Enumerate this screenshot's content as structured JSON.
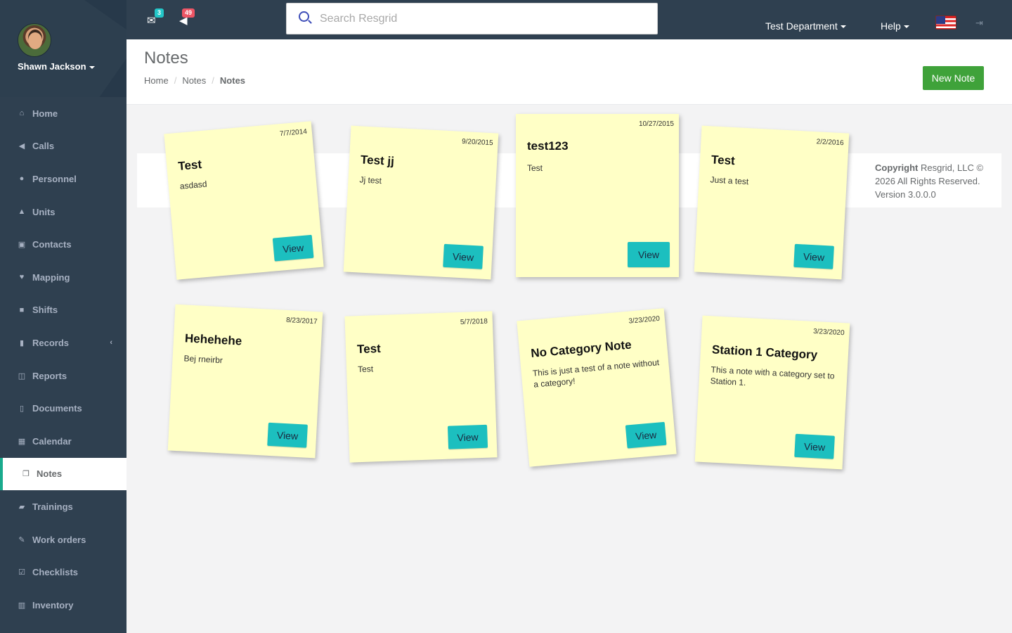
{
  "user": {
    "name": "Shawn Jackson"
  },
  "sidebar": {
    "items": [
      {
        "label": "Home",
        "icon": "home-icon"
      },
      {
        "label": "Calls",
        "icon": "bullhorn-icon"
      },
      {
        "label": "Personnel",
        "icon": "user-icon"
      },
      {
        "label": "Units",
        "icon": "truck-icon"
      },
      {
        "label": "Contacts",
        "icon": "contact-card-icon"
      },
      {
        "label": "Mapping",
        "icon": "map-marker-icon"
      },
      {
        "label": "Shifts",
        "icon": "briefcase-icon"
      },
      {
        "label": "Records",
        "icon": "file-icon",
        "expandable": true
      },
      {
        "label": "Reports",
        "icon": "report-icon"
      },
      {
        "label": "Documents",
        "icon": "document-icon"
      },
      {
        "label": "Calendar",
        "icon": "calendar-icon"
      },
      {
        "label": "Notes",
        "icon": "notes-icon",
        "active": true
      },
      {
        "label": "Trainings",
        "icon": "book-icon"
      },
      {
        "label": "Work orders",
        "icon": "wrench-icon"
      },
      {
        "label": "Checklists",
        "icon": "checkbox-icon"
      },
      {
        "label": "Inventory",
        "icon": "barcode-icon"
      }
    ]
  },
  "topbar": {
    "messages_count": "3",
    "calls_count": "49",
    "search_placeholder": "Search Resgrid",
    "department": "Test Department",
    "help": "Help"
  },
  "page": {
    "title": "Notes",
    "breadcrumb": [
      "Home",
      "Notes",
      "Notes"
    ],
    "new_button": "New Note"
  },
  "footer": {
    "copyright_label": "Copyright",
    "copyright_text": "Resgrid, LLC © 2026 All Rights Reserved.",
    "version": "Version 3.0.0.0"
  },
  "notes": [
    {
      "date": "7/7/2014",
      "title": "Test",
      "body": "asdasd",
      "view": "View"
    },
    {
      "date": "9/20/2015",
      "title": "Test jj",
      "body": "Jj test",
      "view": "View"
    },
    {
      "date": "10/27/2015",
      "title": "test123",
      "body": "Test",
      "view": "View"
    },
    {
      "date": "2/2/2016",
      "title": "Test",
      "body": "Just a test",
      "view": "View"
    },
    {
      "date": "8/23/2017",
      "title": "Hehehehe",
      "body": "Bej rneirbr",
      "view": "View"
    },
    {
      "date": "5/7/2018",
      "title": "Test",
      "body": "Test",
      "view": "View"
    },
    {
      "date": "3/23/2020",
      "title": "No Category Note",
      "body": "This is just a test of a note without a category!",
      "view": "View"
    },
    {
      "date": "3/23/2020",
      "title": "Station 1 Category",
      "body": "This a note with a category set to Station 1.",
      "view": "View"
    }
  ],
  "colors": {
    "sidebar": "#2f4050",
    "note_bg": "#ffffc6",
    "view_button": "#1cbfbf",
    "new_button": "#3fa23a"
  }
}
